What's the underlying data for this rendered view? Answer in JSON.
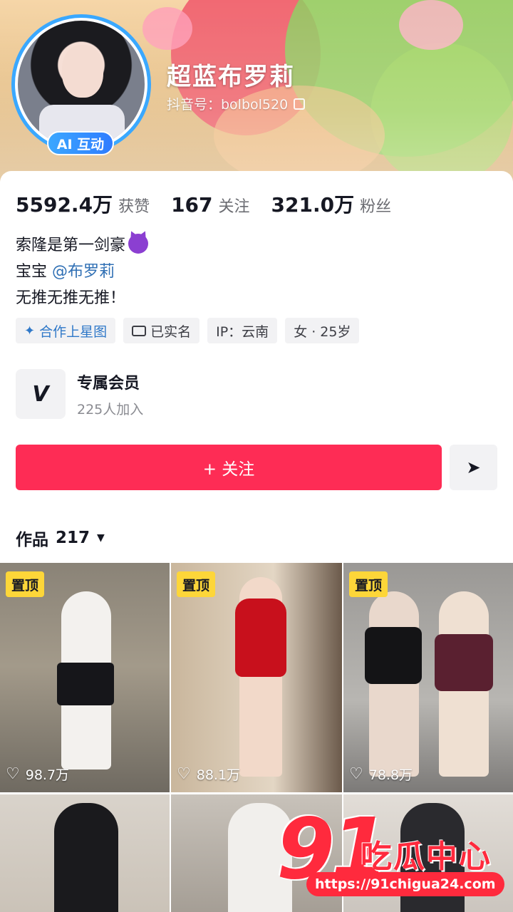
{
  "profile": {
    "nickname": "超蓝布罗莉",
    "douyin_id": "抖音号：bolbol520",
    "ai_badge": "AI 互动"
  },
  "stats": [
    {
      "num": "5592.4万",
      "label": "获赞"
    },
    {
      "num": "167",
      "label": "关注"
    },
    {
      "num": "321.0万",
      "label": "粉丝"
    }
  ],
  "bio": {
    "line1": "索隆是第一剑豪",
    "line2_prefix": "宝宝",
    "line2_mention": "@布罗莉",
    "line3": "无推无推无推！"
  },
  "tags": {
    "xingtu": "合作上星图",
    "verified": "已实名",
    "ip": "IP：云南",
    "gender_age": "女 · 25岁"
  },
  "member": {
    "title": "专属会员",
    "subtitle": "225人加入",
    "logo": "V"
  },
  "actions": {
    "follow": "+ 关注",
    "send_icon": "paper-plane"
  },
  "works": {
    "label": "作品",
    "count": "217"
  },
  "videos": [
    {
      "pinned": "置顶",
      "likes": "98.7万"
    },
    {
      "pinned": "置顶",
      "likes": "88.1万"
    },
    {
      "pinned": "置顶",
      "likes": "78.8万"
    },
    {
      "pinned": "",
      "likes": ""
    },
    {
      "pinned": "",
      "likes": ""
    },
    {
      "pinned": "",
      "likes": ""
    }
  ],
  "watermark": {
    "logo": "91",
    "text": "吃瓜中心",
    "url": "https://91chigua24.com"
  },
  "colors": {
    "follow_button": "#fe2c55",
    "mention": "#2f6fb4",
    "pin_badge": "#fdd639",
    "avatar_ring": "#3aa8ff"
  }
}
